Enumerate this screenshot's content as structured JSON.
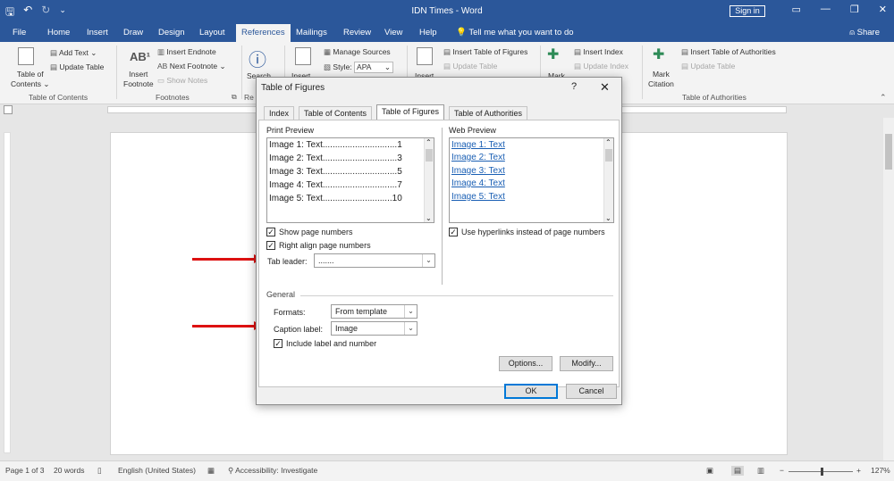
{
  "app": {
    "title": "IDN Times  -  Word",
    "signin": "Sign in",
    "share": "Share",
    "tell_me": "Tell me what you want to do"
  },
  "tabs": [
    "File",
    "Home",
    "Insert",
    "Draw",
    "Design",
    "Layout",
    "References",
    "Mailings",
    "Review",
    "View",
    "Help"
  ],
  "active_tab": "References",
  "ribbon": {
    "toc": {
      "button": "Table of Contents",
      "btn_line1": "Table of",
      "btn_line2": "Contents ⌄",
      "add_text": "Add Text ⌄",
      "update_table": "Update Table",
      "group": "Table of Contents"
    },
    "footnotes": {
      "insert_footnote_1": "Insert",
      "insert_footnote_2": "Footnote",
      "insert_endnote": "Insert Endnote",
      "next_footnote": "Next Footnote ⌄",
      "show_notes": "Show Notes",
      "group": "Footnotes"
    },
    "research": {
      "search": "Search",
      "group": "Re"
    },
    "citations": {
      "insert": "Insert",
      "manage_sources": "Manage Sources",
      "style_label": "Style:",
      "style_value": "APA"
    },
    "captions": {
      "insert": "Insert",
      "insert_table_of_figures": "Insert Table of Figures",
      "update_table": "Update Table"
    },
    "index": {
      "mark": "Mark",
      "insert_index": "Insert Index",
      "update_index": "Update Index"
    },
    "authorities": {
      "mark_1": "Mark",
      "mark_2": "Citation",
      "insert_toa": "Insert Table of Authorities",
      "update_table": "Update Table",
      "group": "Table of Authorities"
    }
  },
  "dialog": {
    "title": "Table of Figures",
    "help": "?",
    "close": "✕",
    "tabs": [
      "Index",
      "Table of Contents",
      "Table of Figures",
      "Table of Authorities"
    ],
    "active_tab": "Table of Figures",
    "print_preview_label": "Print Preview",
    "print_preview_items": [
      "Image 1: Text..............................1",
      "Image 2: Text..............................3",
      "Image 3: Text..............................5",
      "Image 4: Text..............................7",
      "Image 5: Text............................10"
    ],
    "web_preview_label": "Web Preview",
    "web_preview_items": [
      "Image 1: Text",
      "Image 2: Text",
      "Image 3: Text",
      "Image 4: Text",
      "Image 5: Text"
    ],
    "show_page_numbers": "Show page numbers",
    "right_align": "Right align page numbers",
    "use_hyperlinks": "Use hyperlinks instead of page numbers",
    "tab_leader_label": "Tab leader:",
    "tab_leader_value": ".......",
    "general_label": "General",
    "formats_label": "Formats:",
    "formats_value": "From template",
    "caption_label_label": "Caption label:",
    "caption_label_value": "Image",
    "include_label": "Include label and number",
    "options_button": "Options...",
    "modify_button": "Modify...",
    "ok_button": "OK",
    "cancel_button": "Cancel"
  },
  "status": {
    "page": "Page 1 of 3",
    "words": "20 words",
    "language": "English (United States)",
    "accessibility": "Accessibility: Investigate",
    "zoom": "127%",
    "zoom_minus": "−",
    "zoom_plus": "+"
  },
  "colors": {
    "brand": "#2b579a",
    "annotation_arrow": "#dd1111",
    "hyperlink": "#1a5fb4"
  }
}
